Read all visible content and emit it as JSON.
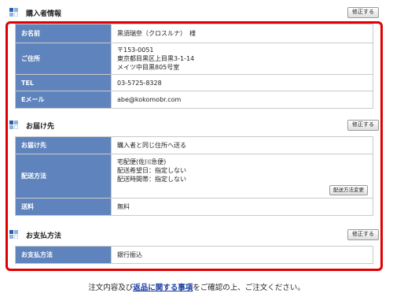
{
  "buyer": {
    "title": "購入者情報",
    "edit_label": "修正する",
    "name_label": "お名前",
    "name_value": "黒須瑞奈（クロスルナ）　様",
    "address_label": "ご住所",
    "address_lines": [
      "〒153-0051",
      "東京都目黒区上目黒3-1-14",
      "メイツ中目黒805号室"
    ],
    "tel_label": "TEL",
    "tel_value": "03-5725-8328",
    "email_label": "Eメール",
    "email_value": "abe@kokomobr.com"
  },
  "delivery": {
    "title": "お届け先",
    "edit_label": "修正する",
    "dest_label": "お届け先",
    "dest_value": "購入者と同じ住所へ送る",
    "method_label": "配送方法",
    "method_lines": [
      "宅配便(佐川急便)",
      "配送希望日：指定しない",
      "配送時間帯：指定しない"
    ],
    "change_label": "配送方法変更",
    "fee_label": "送料",
    "fee_value": "無料"
  },
  "payment": {
    "title": "お支払方法",
    "edit_label": "修正する",
    "method_label": "お支払方法",
    "method_value": "銀行振込"
  },
  "footer": {
    "before": "注文内容及び",
    "link": "返品に関する事項",
    "after": "をご確認の上、ご注文ください。"
  }
}
